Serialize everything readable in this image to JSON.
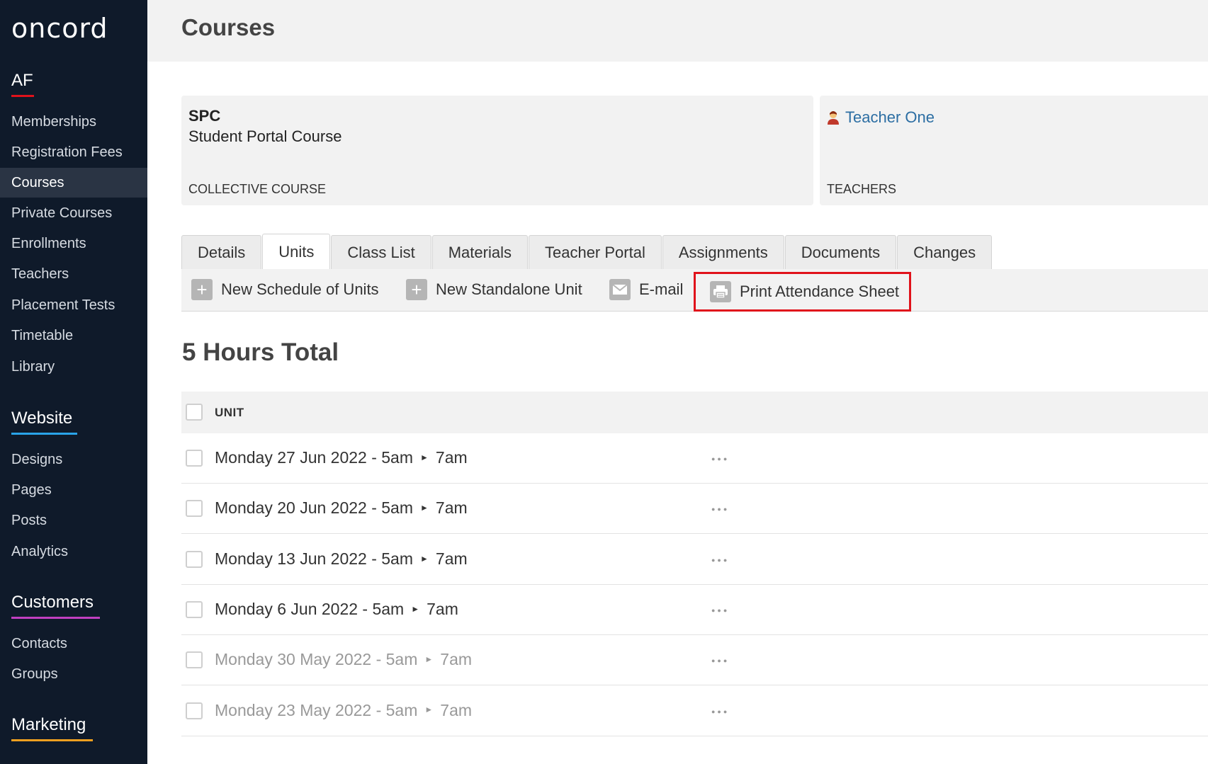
{
  "brand": {
    "logo_text": "oncord"
  },
  "sidebar": {
    "sections": [
      {
        "title": "AF",
        "accent": "#e0121b"
      },
      {
        "title": "Website",
        "accent": "#2aa4e8"
      },
      {
        "title": "Customers",
        "accent": "#c040c0"
      },
      {
        "title": "Marketing",
        "accent": "#f0a020"
      }
    ],
    "af_items": [
      "Memberships",
      "Registration Fees",
      "Courses",
      "Private Courses",
      "Enrollments",
      "Teachers",
      "Placement Tests",
      "Timetable",
      "Library"
    ],
    "website_items": [
      "Designs",
      "Pages",
      "Posts",
      "Analytics"
    ],
    "customers_items": [
      "Contacts",
      "Groups"
    ],
    "active_item": "Courses"
  },
  "header": {
    "title": "Courses"
  },
  "course_card": {
    "code": "SPC",
    "name": "Student Portal Course",
    "caption": "COLLECTIVE COURSE"
  },
  "teachers_card": {
    "teacher": "Teacher One",
    "caption": "TEACHERS"
  },
  "tabs": [
    "Details",
    "Units",
    "Class List",
    "Materials",
    "Teacher Portal",
    "Assignments",
    "Documents",
    "Changes"
  ],
  "active_tab": "Units",
  "toolbar": {
    "new_schedule": "New Schedule of Units",
    "new_standalone": "New Standalone Unit",
    "email": "E-mail",
    "print_attendance": "Print Attendance Sheet"
  },
  "summary": {
    "hours_total": "5 Hours Total"
  },
  "table": {
    "column_header": "UNIT",
    "rows": [
      {
        "start": "Monday 27 Jun 2022 - 5am",
        "end": "7am",
        "past": false
      },
      {
        "start": "Monday 20 Jun 2022 - 5am",
        "end": "7am",
        "past": false
      },
      {
        "start": "Monday 13 Jun 2022 - 5am",
        "end": "7am",
        "past": false
      },
      {
        "start": "Monday 6 Jun 2022 - 5am",
        "end": "7am",
        "past": false
      },
      {
        "start": "Monday 30 May 2022 - 5am",
        "end": "7am",
        "past": true
      },
      {
        "start": "Monday 23 May 2022 - 5am",
        "end": "7am",
        "past": true
      }
    ]
  },
  "colors": {
    "sidebar_bg": "#0f1a2a",
    "highlight_border": "#e0121b",
    "link": "#2c6ea3"
  }
}
